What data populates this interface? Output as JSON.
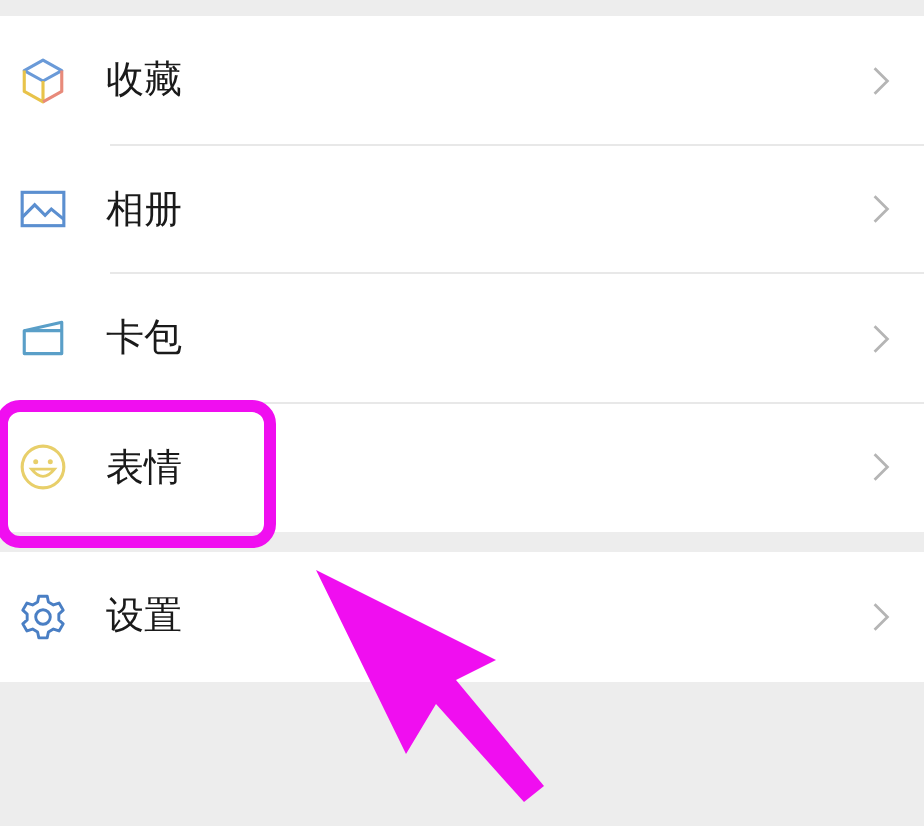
{
  "groups": [
    {
      "items": [
        {
          "kind": "cube",
          "label": "收藏",
          "highlighted": false
        },
        {
          "kind": "picture",
          "label": "相册",
          "highlighted": false
        },
        {
          "kind": "card",
          "label": "卡包",
          "highlighted": false
        },
        {
          "kind": "smile",
          "label": "表情",
          "highlighted": true
        }
      ]
    },
    {
      "items": [
        {
          "kind": "gear",
          "label": "设置",
          "highlighted": false
        }
      ]
    }
  ]
}
